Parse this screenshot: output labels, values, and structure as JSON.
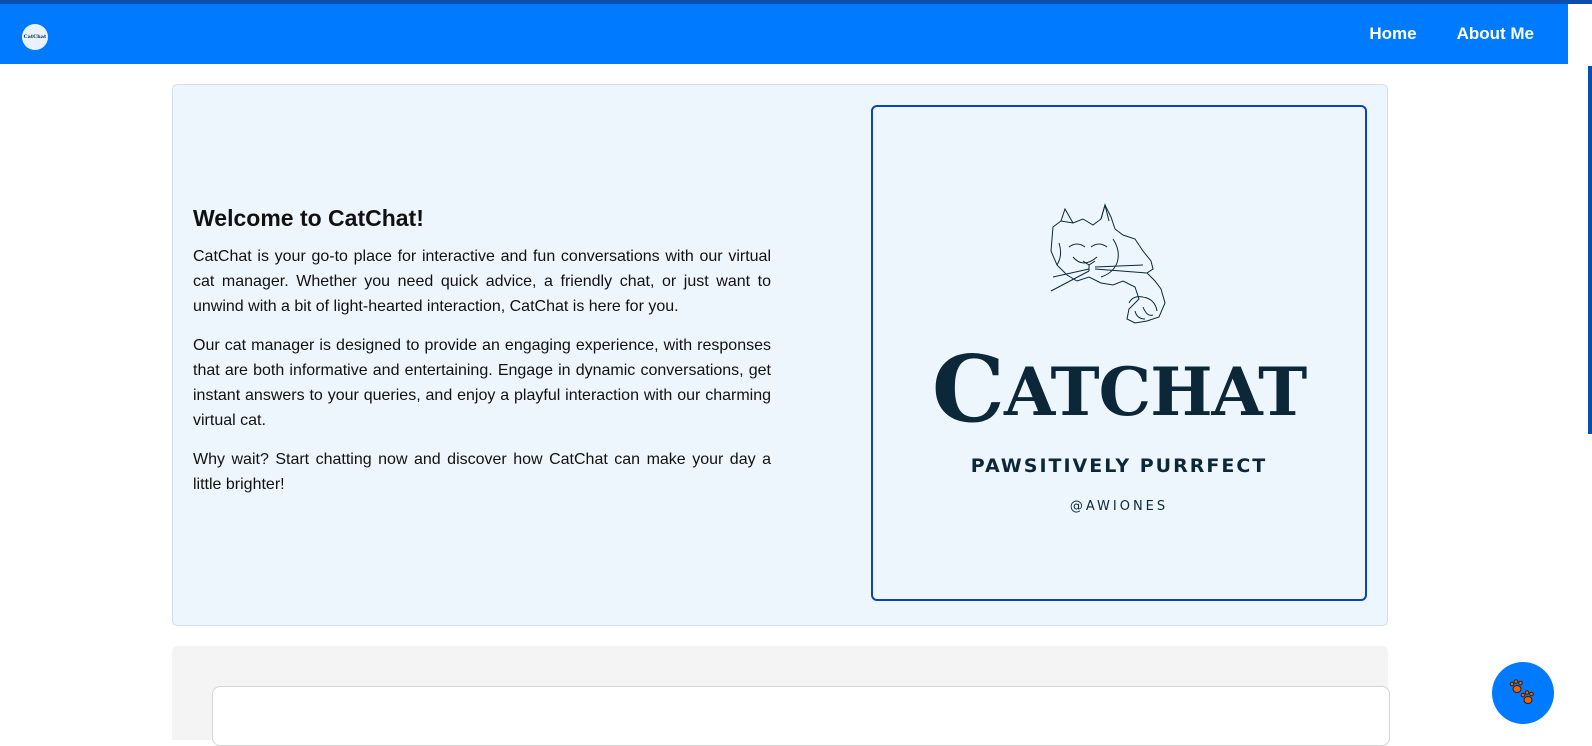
{
  "navbar": {
    "logo_text": "CatChat",
    "links": [
      "Home",
      "About Me"
    ],
    "background": "#007bff"
  },
  "hero": {
    "title": "Welcome to CatChat!",
    "paragraphs": [
      "CatChat is your go-to place for interactive and fun conversations with our virtual cat manager. Whether you need quick advice, a friendly chat, or just want to unwind with a bit of light-hearted interaction, CatChat is here for you.",
      "Our cat manager is designed to provide an engaging experience, with responses that are both informative and entertaining. Engage in dynamic conversations, get instant answers to your queries, and enjoy a playful interaction with our charming virtual cat.",
      "Why wait? Start chatting now and discover how CatChat can make your day a little brighter!"
    ],
    "logo": {
      "brand_first": "C",
      "brand_rest": "ATCHAT",
      "tagline": "PAWSITIVELY PURRFECT",
      "handle": "@AWIONES"
    }
  },
  "chat_launcher": {
    "icon": "paw-icon",
    "color": "#007bff"
  }
}
